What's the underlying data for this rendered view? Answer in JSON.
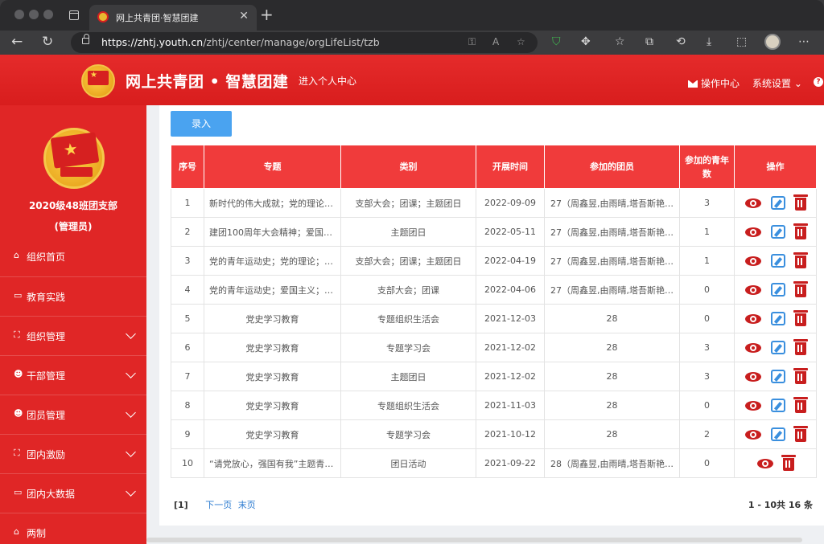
{
  "browser": {
    "tab_title": "网上共青团·智慧团建",
    "url_host": "https://zhtj.youth.cn",
    "url_path": "/zhtj/center/manage/orgLifeList/tzb"
  },
  "header": {
    "site_title": "网上共青团 • 智慧团建",
    "personal_center": "进入个人中心",
    "op_center": "操作中心",
    "sys_settings": "系统设置"
  },
  "sidebar": {
    "org_name": "2020级48班团支部",
    "org_role": "(管理员)",
    "items": [
      {
        "label": "组织首页",
        "icon": "home-icon"
      },
      {
        "label": "教育实践",
        "icon": "folder-icon"
      },
      {
        "label": "组织管理",
        "icon": "sitemap-icon"
      },
      {
        "label": "干部管理",
        "icon": "users-icon"
      },
      {
        "label": "团员管理",
        "icon": "users-icon"
      },
      {
        "label": "团内激励",
        "icon": "sitemap-icon"
      },
      {
        "label": "团内大数据",
        "icon": "folder-icon"
      },
      {
        "label": "两制",
        "icon": "home-icon"
      }
    ]
  },
  "toolbar": {
    "add_label": "录入"
  },
  "table": {
    "headers": [
      "序号",
      "专题",
      "类别",
      "开展时间",
      "参加的团员",
      "参加的青年数",
      "操作"
    ],
    "rows": [
      {
        "no": "1",
        "topic": "新时代的伟大成就；党的理论…",
        "category": "支部大会；团课；主题团日",
        "date": "2022-09-09",
        "members": "27（周鑫昱,由雨晴,塔吾斯艳…",
        "youth": "3"
      },
      {
        "no": "2",
        "topic": "建团100周年大会精神；爱国…",
        "category": "主题团日",
        "date": "2022-05-11",
        "members": "27（周鑫昱,由雨晴,塔吾斯艳…",
        "youth": "1"
      },
      {
        "no": "3",
        "topic": "党的青年运动史；党的理论；…",
        "category": "支部大会；团课；主题团日",
        "date": "2022-04-19",
        "members": "27（周鑫昱,由雨晴,塔吾斯艳…",
        "youth": "1"
      },
      {
        "no": "4",
        "topic": "党的青年运动史；爱国主义；…",
        "category": "支部大会；团课",
        "date": "2022-04-06",
        "members": "27（周鑫昱,由雨晴,塔吾斯艳…",
        "youth": "0"
      },
      {
        "no": "5",
        "topic": "党史学习教育",
        "category": "专题组织生活会",
        "date": "2021-12-03",
        "members": "28",
        "youth": "0"
      },
      {
        "no": "6",
        "topic": "党史学习教育",
        "category": "专题学习会",
        "date": "2021-12-02",
        "members": "28",
        "youth": "3"
      },
      {
        "no": "7",
        "topic": "党史学习教育",
        "category": "主题团日",
        "date": "2021-12-02",
        "members": "28",
        "youth": "3"
      },
      {
        "no": "8",
        "topic": "党史学习教育",
        "category": "专题组织生活会",
        "date": "2021-11-03",
        "members": "28",
        "youth": "0"
      },
      {
        "no": "9",
        "topic": "党史学习教育",
        "category": "专题学习会",
        "date": "2021-10-12",
        "members": "28",
        "youth": "2"
      },
      {
        "no": "10",
        "topic": "“请党放心，强国有我”主题青…",
        "category": "团日活动",
        "date": "2021-09-22",
        "members": "28（周鑫昱,由雨晴,塔吾斯艳…",
        "youth": "0"
      }
    ]
  },
  "pager": {
    "current": "[1]",
    "next": "下一页",
    "last": "末页",
    "summary": "1 - 10共 16 条"
  }
}
